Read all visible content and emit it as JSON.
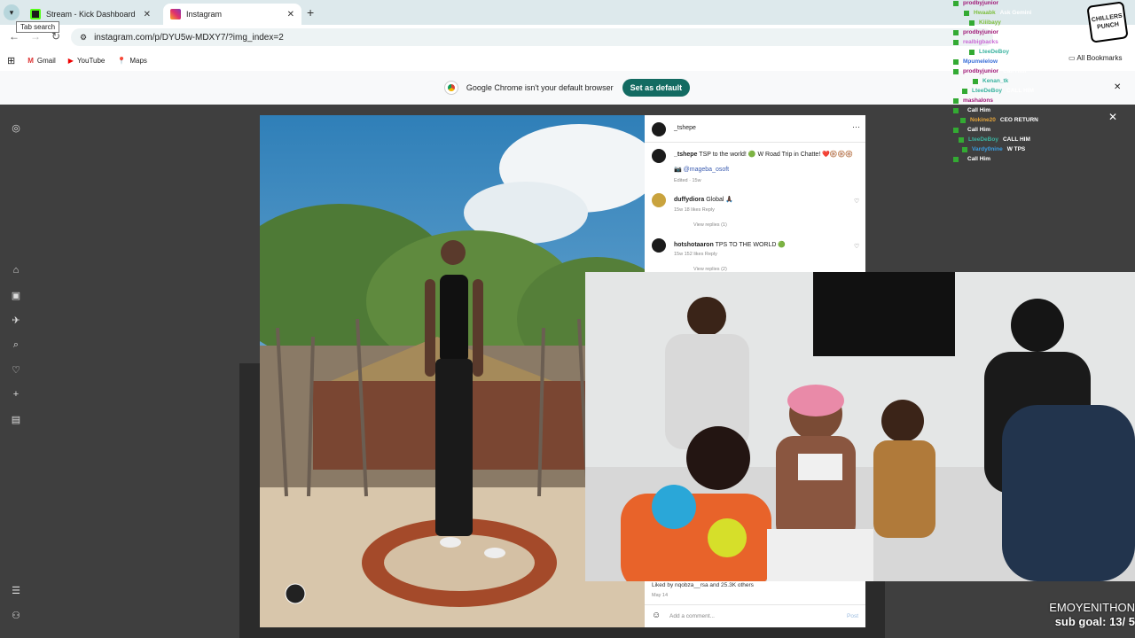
{
  "tabs": [
    {
      "label": "Stream - Kick Dashboard",
      "icon": "kick-icon"
    },
    {
      "label": "Instagram",
      "icon": "instagram-icon"
    }
  ],
  "tooltip": "Tab search",
  "url": "instagram.com/p/DYU5w-MDXY7/?img_index=2",
  "bookmarks": [
    "Gmail",
    "YouTube",
    "Maps"
  ],
  "all_bookmarks": "All Bookmarks",
  "banner": {
    "text": "Google Chrome isn't your default browser",
    "button": "Set as default"
  },
  "post": {
    "username": "_tshepe",
    "caption_user": "_tshepe",
    "caption": "TSP to the world! 🟢 W Road Trip in Chatte! ❤️🛞🛞🛞",
    "mention": "📷 @mageba_osoft",
    "caption_meta": "Edited · 15w",
    "comments": [
      {
        "user": "duffydiora",
        "text": "Global 🙏🏿",
        "meta": "15w  18 likes  Reply",
        "replies": "View replies (1)"
      },
      {
        "user": "hotshotaaron",
        "text": "TPS TO THE WORLD 🟢",
        "meta": "15w  152 likes  Reply",
        "replies": "View replies (2)"
      }
    ],
    "likes": "Liked by nqobza__rsa and 25.3K others",
    "date": "May 14",
    "add_comment": "Add a comment...",
    "post_btn": "Post"
  },
  "chat": [
    {
      "user": "prodbyjunior",
      "msg": "",
      "color": "#a01a78"
    },
    {
      "user": "Hwaabk",
      "msg": "Ask Gemini",
      "color": "#7fbf3f"
    },
    {
      "user": "Kiiibayy",
      "msg": "",
      "color": "#7fbf3f"
    },
    {
      "user": "prodbyjunior",
      "msg": "",
      "color": "#a01a78"
    },
    {
      "user": "realbigbacks",
      "msg": "",
      "color": "#c96ad6"
    },
    {
      "user": "LteeDeBoy",
      "msg": "",
      "color": "#3bb3a0"
    },
    {
      "user": "Mpumelelow",
      "msg": "",
      "color": "#3a6fd8"
    },
    {
      "user": "prodbyjunior",
      "msg": "Call Him",
      "color": "#a01a78"
    },
    {
      "user": "Kenan_tk",
      "msg": "",
      "color": "#3bb3a0"
    },
    {
      "user": "LteeDeBoy",
      "msg": "CALL HIM",
      "color": "#3bb3a0"
    },
    {
      "user": "mashalons",
      "msg": "",
      "color": "#a01a78"
    },
    {
      "user": "",
      "msg": "Call Him",
      "color": "#d02020"
    },
    {
      "user": "Nokine20",
      "msg": "CEO RETURN",
      "color": "#e3a33a"
    },
    {
      "user": "",
      "msg": "Call Him",
      "color": "#d02020"
    },
    {
      "user": "LteeDeBoy",
      "msg": "CALL HIM",
      "color": "#3bb3a0"
    },
    {
      "user": "Vardy0nine",
      "msg": "W TPS",
      "color": "#3a9de0"
    },
    {
      "user": "",
      "msg": "Call Him",
      "color": "#d02020"
    }
  ],
  "logo_text": "CHILLERS PUNCH",
  "overlay": {
    "line1": "EMOYENITHON",
    "line2": "sub goal: 13/ 5"
  }
}
